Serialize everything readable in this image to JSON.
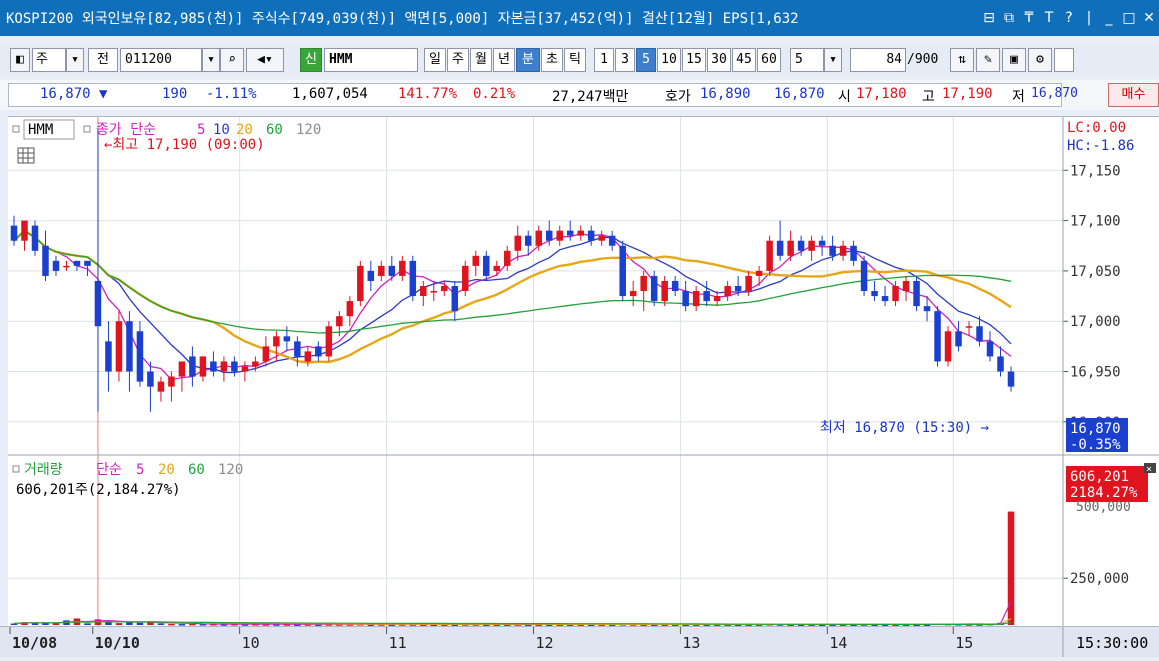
{
  "title_bar": {
    "text": "KOSPI200 외국인보유[82,985(천)] 주식수[749,039(천)] 액면[5,000] 자본금[37,452(억)] 결산[12월] EPS[1,632",
    "buttons": [
      "⊟",
      "⧉",
      "₸",
      "T",
      "?",
      "|",
      "_",
      "□",
      "✕"
    ]
  },
  "toolbar": {
    "mode1": "주",
    "mode2": "전",
    "code": "011200",
    "name_tag": "신",
    "name": "HMM",
    "periods": [
      "일",
      "주",
      "월",
      "년",
      "분",
      "초",
      "틱"
    ],
    "active_period": "분",
    "intervals": [
      "1",
      "3",
      "5",
      "10",
      "15",
      "30",
      "45",
      "60"
    ],
    "active_interval": "5",
    "interval_input": "5",
    "count": "84",
    "count_total": "/900"
  },
  "quote": {
    "price": "16,870",
    "change": "190",
    "change_pct": "-1.11%",
    "volume": "1,607,054",
    "volume_ratio": "141.77%",
    "turnover": "0.21%",
    "amount": "27,247백만",
    "bid_label": "호가",
    "bid1": "16,890",
    "bid2": "16,870",
    "open_label": "시",
    "open": "17,180",
    "high_label": "고",
    "high": "17,190",
    "low_label": "저",
    "low": "16,870",
    "buy_button": "매수"
  },
  "price_chart": {
    "legend_name": "HMM",
    "legend_label": "종가 단순",
    "ma_periods": [
      "5",
      "10",
      "20",
      "60",
      "120"
    ],
    "ma_colors": [
      "#d21fbf",
      "#2b39c9",
      "#e6a718",
      "#22a33a",
      "#8c8c8c"
    ],
    "high_annotation": "←최고 17,190 (09:00)",
    "low_annotation": "최저 16,870 (15:30) →",
    "lc_label": "LC:0.00",
    "hc_label": "HC:-1.86",
    "current_price": "16,870",
    "current_pct": "-0.35%"
  },
  "volume_chart": {
    "legend_label": "거래량",
    "legend_ma": "단순",
    "ma_periods": [
      "5",
      "20",
      "60",
      "120"
    ],
    "summary": "606,201주(2,184.27%)",
    "current_volume": "606,201",
    "current_pct": "2184.27%",
    "partial_tick": "500,000"
  },
  "chart_data": {
    "type": "candlestick",
    "y_ticks": [
      17150,
      17100,
      17050,
      17000,
      16950,
      16900
    ],
    "ylim": [
      16875,
      17195
    ],
    "volume_ticks": [
      250000
    ],
    "volume_ylim": [
      0,
      620000
    ],
    "x_labels": [
      "10/08",
      "10/10",
      "10",
      "11",
      "12",
      "13",
      "14",
      "15"
    ],
    "time_label": "15:30:00",
    "candles": [
      {
        "o": 17095,
        "h": 17105,
        "l": 17075,
        "c": 17080
      },
      {
        "o": 17080,
        "h": 17100,
        "l": 17070,
        "c": 17100
      },
      {
        "o": 17095,
        "h": 17100,
        "l": 17065,
        "c": 17070
      },
      {
        "o": 17075,
        "h": 17090,
        "l": 17040,
        "c": 17045
      },
      {
        "o": 17060,
        "h": 17065,
        "l": 17045,
        "c": 17050
      },
      {
        "o": 17055,
        "h": 17060,
        "l": 17050,
        "c": 17055
      },
      {
        "o": 17060,
        "h": 17060,
        "l": 17050,
        "c": 17055
      },
      {
        "o": 17060,
        "h": 17060,
        "l": 17045,
        "c": 17055
      },
      {
        "o": 17040,
        "h": 17190,
        "l": 16910,
        "c": 16995
      },
      {
        "o": 16980,
        "h": 17000,
        "l": 16930,
        "c": 16950
      },
      {
        "o": 16950,
        "h": 17010,
        "l": 16940,
        "c": 17000
      },
      {
        "o": 17000,
        "h": 17010,
        "l": 16930,
        "c": 16950
      },
      {
        "o": 16990,
        "h": 17000,
        "l": 16935,
        "c": 16940
      },
      {
        "o": 16950,
        "h": 16960,
        "l": 16910,
        "c": 16935
      },
      {
        "o": 16930,
        "h": 16945,
        "l": 16920,
        "c": 16940
      },
      {
        "o": 16935,
        "h": 16950,
        "l": 16920,
        "c": 16945
      },
      {
        "o": 16945,
        "h": 16960,
        "l": 16930,
        "c": 16960
      },
      {
        "o": 16965,
        "h": 16975,
        "l": 16935,
        "c": 16945
      },
      {
        "o": 16945,
        "h": 16965,
        "l": 16940,
        "c": 16965
      },
      {
        "o": 16960,
        "h": 16970,
        "l": 16945,
        "c": 16950
      },
      {
        "o": 16950,
        "h": 16965,
        "l": 16940,
        "c": 16960
      },
      {
        "o": 16960,
        "h": 16965,
        "l": 16945,
        "c": 16950
      },
      {
        "o": 16950,
        "h": 16960,
        "l": 16940,
        "c": 16955
      },
      {
        "o": 16955,
        "h": 16965,
        "l": 16950,
        "c": 16960
      },
      {
        "o": 16960,
        "h": 16985,
        "l": 16955,
        "c": 16975
      },
      {
        "o": 16975,
        "h": 16990,
        "l": 16960,
        "c": 16985
      },
      {
        "o": 16985,
        "h": 16995,
        "l": 16970,
        "c": 16980
      },
      {
        "o": 16980,
        "h": 16985,
        "l": 16955,
        "c": 16965
      },
      {
        "o": 16960,
        "h": 16975,
        "l": 16955,
        "c": 16970
      },
      {
        "o": 16975,
        "h": 16980,
        "l": 16960,
        "c": 16965
      },
      {
        "o": 16965,
        "h": 17000,
        "l": 16960,
        "c": 16995
      },
      {
        "o": 16995,
        "h": 17010,
        "l": 16985,
        "c": 17005
      },
      {
        "o": 17005,
        "h": 17025,
        "l": 16995,
        "c": 17020
      },
      {
        "o": 17020,
        "h": 17060,
        "l": 17015,
        "c": 17055
      },
      {
        "o": 17050,
        "h": 17060,
        "l": 17030,
        "c": 17040
      },
      {
        "o": 17045,
        "h": 17060,
        "l": 17040,
        "c": 17055
      },
      {
        "o": 17055,
        "h": 17065,
        "l": 17040,
        "c": 17045
      },
      {
        "o": 17045,
        "h": 17065,
        "l": 17040,
        "c": 17060
      },
      {
        "o": 17060,
        "h": 17065,
        "l": 17020,
        "c": 17025
      },
      {
        "o": 17025,
        "h": 17040,
        "l": 17015,
        "c": 17035
      },
      {
        "o": 17030,
        "h": 17040,
        "l": 17020,
        "c": 17030
      },
      {
        "o": 17030,
        "h": 17040,
        "l": 17025,
        "c": 17035
      },
      {
        "o": 17035,
        "h": 17040,
        "l": 17000,
        "c": 17010
      },
      {
        "o": 17030,
        "h": 17060,
        "l": 17025,
        "c": 17055
      },
      {
        "o": 17055,
        "h": 17070,
        "l": 17045,
        "c": 17065
      },
      {
        "o": 17065,
        "h": 17070,
        "l": 17040,
        "c": 17045
      },
      {
        "o": 17050,
        "h": 17060,
        "l": 17045,
        "c": 17055
      },
      {
        "o": 17055,
        "h": 17075,
        "l": 17050,
        "c": 17070
      },
      {
        "o": 17070,
        "h": 17095,
        "l": 17060,
        "c": 17085
      },
      {
        "o": 17085,
        "h": 17090,
        "l": 17065,
        "c": 17075
      },
      {
        "o": 17075,
        "h": 17095,
        "l": 17070,
        "c": 17090
      },
      {
        "o": 17090,
        "h": 17100,
        "l": 17075,
        "c": 17080
      },
      {
        "o": 17080,
        "h": 17095,
        "l": 17075,
        "c": 17090
      },
      {
        "o": 17090,
        "h": 17100,
        "l": 17080,
        "c": 17085
      },
      {
        "o": 17085,
        "h": 17095,
        "l": 17080,
        "c": 17090
      },
      {
        "o": 17090,
        "h": 17095,
        "l": 17075,
        "c": 17080
      },
      {
        "o": 17080,
        "h": 17090,
        "l": 17075,
        "c": 17085
      },
      {
        "o": 17085,
        "h": 17090,
        "l": 17070,
        "c": 17075
      },
      {
        "o": 17075,
        "h": 17080,
        "l": 17020,
        "c": 17025
      },
      {
        "o": 17025,
        "h": 17040,
        "l": 17015,
        "c": 17030
      },
      {
        "o": 17030,
        "h": 17050,
        "l": 17010,
        "c": 17045
      },
      {
        "o": 17045,
        "h": 17050,
        "l": 17015,
        "c": 17020
      },
      {
        "o": 17020,
        "h": 17045,
        "l": 17015,
        "c": 17040
      },
      {
        "o": 17040,
        "h": 17045,
        "l": 17025,
        "c": 17030
      },
      {
        "o": 17030,
        "h": 17040,
        "l": 17010,
        "c": 17015
      },
      {
        "o": 17015,
        "h": 17035,
        "l": 17010,
        "c": 17030
      },
      {
        "o": 17030,
        "h": 17040,
        "l": 17015,
        "c": 17020
      },
      {
        "o": 17020,
        "h": 17030,
        "l": 17015,
        "c": 17025
      },
      {
        "o": 17025,
        "h": 17040,
        "l": 17020,
        "c": 17035
      },
      {
        "o": 17035,
        "h": 17045,
        "l": 17025,
        "c": 17030
      },
      {
        "o": 17030,
        "h": 17050,
        "l": 17025,
        "c": 17045
      },
      {
        "o": 17045,
        "h": 17055,
        "l": 17035,
        "c": 17050
      },
      {
        "o": 17050,
        "h": 17085,
        "l": 17045,
        "c": 17080
      },
      {
        "o": 17080,
        "h": 17100,
        "l": 17060,
        "c": 17065
      },
      {
        "o": 17065,
        "h": 17090,
        "l": 17060,
        "c": 17080
      },
      {
        "o": 17080,
        "h": 17085,
        "l": 17065,
        "c": 17070
      },
      {
        "o": 17070,
        "h": 17085,
        "l": 17060,
        "c": 17080
      },
      {
        "o": 17080,
        "h": 17085,
        "l": 17065,
        "c": 17075
      },
      {
        "o": 17075,
        "h": 17085,
        "l": 17060,
        "c": 17065
      },
      {
        "o": 17065,
        "h": 17080,
        "l": 17060,
        "c": 17075
      },
      {
        "o": 17075,
        "h": 17080,
        "l": 17055,
        "c": 17060
      },
      {
        "o": 17060,
        "h": 17065,
        "l": 17025,
        "c": 17030
      },
      {
        "o": 17030,
        "h": 17040,
        "l": 17020,
        "c": 17025
      },
      {
        "o": 17025,
        "h": 17035,
        "l": 17015,
        "c": 17020
      },
      {
        "o": 17020,
        "h": 17040,
        "l": 17015,
        "c": 17035
      },
      {
        "o": 17030,
        "h": 17045,
        "l": 17020,
        "c": 17040
      },
      {
        "o": 17040,
        "h": 17045,
        "l": 17010,
        "c": 17015
      },
      {
        "o": 17015,
        "h": 17025,
        "l": 17000,
        "c": 17010
      },
      {
        "o": 17010,
        "h": 17015,
        "l": 16955,
        "c": 16960
      },
      {
        "o": 16960,
        "h": 16995,
        "l": 16955,
        "c": 16990
      },
      {
        "o": 16990,
        "h": 17000,
        "l": 16970,
        "c": 16975
      },
      {
        "o": 16995,
        "h": 17000,
        "l": 16985,
        "c": 16995
      },
      {
        "o": 16995,
        "h": 17005,
        "l": 16975,
        "c": 16980
      },
      {
        "o": 16980,
        "h": 16990,
        "l": 16960,
        "c": 16965
      },
      {
        "o": 16965,
        "h": 16975,
        "l": 16945,
        "c": 16950
      },
      {
        "o": 16950,
        "h": 16955,
        "l": 16930,
        "c": 16935
      }
    ],
    "volumes": [
      {
        "v": 8000,
        "up": false
      },
      {
        "v": 15000,
        "up": true
      },
      {
        "v": 12000,
        "up": false
      },
      {
        "v": 10000,
        "up": false
      },
      {
        "v": 12000,
        "up": true
      },
      {
        "v": 25000,
        "up": false
      },
      {
        "v": 35000,
        "up": true
      },
      {
        "v": 9000,
        "up": false
      },
      {
        "v": 30000,
        "up": true
      },
      {
        "v": 18000,
        "up": false
      },
      {
        "v": 10000,
        "up": true
      },
      {
        "v": 14000,
        "up": false
      },
      {
        "v": 12000,
        "up": false
      },
      {
        "v": 20000,
        "up": true
      },
      {
        "v": 8000,
        "up": false
      },
      {
        "v": 6000,
        "up": true
      },
      {
        "v": 5000,
        "up": false
      },
      {
        "v": 6000,
        "up": true
      },
      {
        "v": 5000,
        "up": false
      },
      {
        "v": 5000,
        "up": true
      },
      {
        "v": 4000,
        "up": false
      },
      {
        "v": 5000,
        "up": true
      },
      {
        "v": 4000,
        "up": false
      },
      {
        "v": 5000,
        "up": true
      },
      {
        "v": 4000,
        "up": true
      },
      {
        "v": 4000,
        "up": false
      },
      {
        "v": 4000,
        "up": true
      },
      {
        "v": 3000,
        "up": false
      },
      {
        "v": 4000,
        "up": true
      },
      {
        "v": 3000,
        "up": false
      },
      {
        "v": 4000,
        "up": true
      },
      {
        "v": 4000,
        "up": true
      },
      {
        "v": 4000,
        "up": true
      },
      {
        "v": 5000,
        "up": true
      },
      {
        "v": 3000,
        "up": false
      },
      {
        "v": 4000,
        "up": true
      },
      {
        "v": 3000,
        "up": false
      },
      {
        "v": 4000,
        "up": true
      },
      {
        "v": 4000,
        "up": false
      },
      {
        "v": 3000,
        "up": true
      },
      {
        "v": 3000,
        "up": false
      },
      {
        "v": 3000,
        "up": true
      },
      {
        "v": 3000,
        "up": false
      },
      {
        "v": 4000,
        "up": true
      },
      {
        "v": 4000,
        "up": true
      },
      {
        "v": 3000,
        "up": false
      },
      {
        "v": 3000,
        "up": true
      },
      {
        "v": 3000,
        "up": true
      },
      {
        "v": 4000,
        "up": true
      },
      {
        "v": 3000,
        "up": false
      },
      {
        "v": 3000,
        "up": true
      },
      {
        "v": 3000,
        "up": false
      },
      {
        "v": 3000,
        "up": true
      },
      {
        "v": 3000,
        "up": false
      },
      {
        "v": 3000,
        "up": true
      },
      {
        "v": 3000,
        "up": false
      },
      {
        "v": 3000,
        "up": true
      },
      {
        "v": 3000,
        "up": false
      },
      {
        "v": 5000,
        "up": false
      },
      {
        "v": 4000,
        "up": true
      },
      {
        "v": 3000,
        "up": true
      },
      {
        "v": 3000,
        "up": false
      },
      {
        "v": 3000,
        "up": true
      },
      {
        "v": 3000,
        "up": false
      },
      {
        "v": 3000,
        "up": false
      },
      {
        "v": 3000,
        "up": true
      },
      {
        "v": 3000,
        "up": false
      },
      {
        "v": 3000,
        "up": true
      },
      {
        "v": 3000,
        "up": true
      },
      {
        "v": 3000,
        "up": false
      },
      {
        "v": 3000,
        "up": true
      },
      {
        "v": 3000,
        "up": true
      },
      {
        "v": 5000,
        "up": true
      },
      {
        "v": 4000,
        "up": false
      },
      {
        "v": 3000,
        "up": true
      },
      {
        "v": 3000,
        "up": false
      },
      {
        "v": 3000,
        "up": true
      },
      {
        "v": 3000,
        "up": false
      },
      {
        "v": 3000,
        "up": false
      },
      {
        "v": 3000,
        "up": true
      },
      {
        "v": 3000,
        "up": false
      },
      {
        "v": 4000,
        "up": false
      },
      {
        "v": 3000,
        "up": false
      },
      {
        "v": 3000,
        "up": false
      },
      {
        "v": 3000,
        "up": true
      },
      {
        "v": 3000,
        "up": true
      },
      {
        "v": 3000,
        "up": false
      },
      {
        "v": 3000,
        "up": false
      },
      {
        "v": 8000,
        "up": false
      },
      {
        "v": 6000,
        "up": true
      },
      {
        "v": 5000,
        "up": false
      },
      {
        "v": 4000,
        "up": true
      },
      {
        "v": 4000,
        "up": false
      },
      {
        "v": 6000,
        "up": false
      },
      {
        "v": 12000,
        "up": false
      },
      {
        "v": 606201,
        "up": true
      }
    ]
  }
}
